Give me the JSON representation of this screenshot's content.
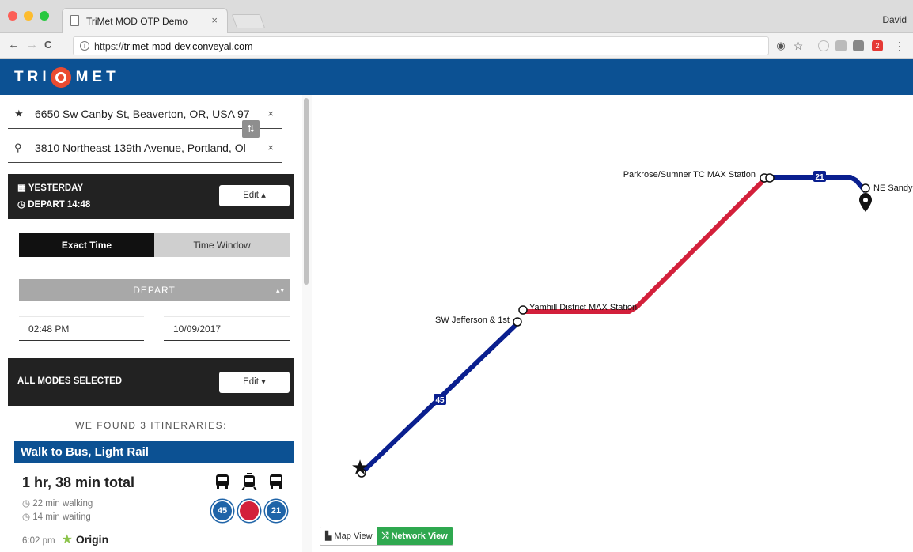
{
  "browser": {
    "tab_title": "TriMet MOD OTP Demo",
    "tab_close": "×",
    "user": "David",
    "url_prefix": "https://",
    "url_host": "trimet-mod-dev.conveyal.com",
    "info_glyph": "i",
    "back_glyph": "←",
    "forward_glyph": "→",
    "reload_glyph": "C",
    "extension_badge": "2"
  },
  "header": {
    "logo_left": "TRI",
    "logo_right": "MET",
    "color": "#0c5193"
  },
  "form": {
    "origin": "6650 Sw Canby St, Beaverton, OR, USA 97",
    "destination": "3810 Northeast 139th Avenue, Portland, Ol",
    "clear_glyph": "×",
    "swap_glyph": "⇅",
    "date_label": "YESTERDAY",
    "time_label": "DEPART 14:48",
    "edit_label_up": "Edit ▴",
    "tab_exact": "Exact Time",
    "tab_window": "Time Window",
    "depart_select": "DEPART",
    "time_value": "02:48 PM",
    "date_value": "10/09/2017",
    "modes_label": "ALL MODES SELECTED",
    "edit_label_down": "Edit ▾"
  },
  "results": {
    "found_label": "WE FOUND 3 ITINERARIES:",
    "itinerary_title": "Walk to Bus, Light Rail",
    "total": "1 hr, 38 min total",
    "walking": "22 min walking",
    "waiting": "14 min waiting",
    "routes": [
      "45",
      "",
      "21"
    ],
    "origin_time": "6:02 pm",
    "origin_label": "Origin"
  },
  "map": {
    "stops": {
      "parkrose": "Parkrose/Sumner TC MAX Station",
      "ne_sandy": "NE Sandy",
      "yamhill": "Yamhill District MAX Station",
      "jefferson": "SW Jefferson & 1st"
    },
    "route_badges": {
      "blue_upper": "21",
      "blue_lower": "45"
    },
    "colors": {
      "bus": "#0a1f8f",
      "rail": "#d3203b"
    },
    "map_view": "Map View",
    "network_view": "Network View"
  }
}
